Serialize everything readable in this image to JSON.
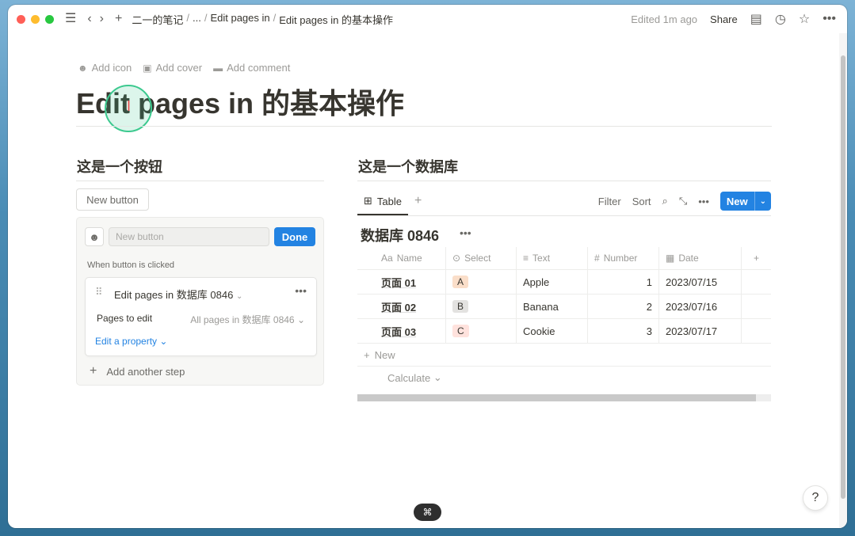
{
  "titlebar": {
    "breadcrumbs": [
      "二一的笔记",
      "...",
      "Edit pages in",
      "Edit pages in 的基本操作"
    ],
    "edited": "Edited 1m ago",
    "share": "Share"
  },
  "page": {
    "actions": [
      "Add icon",
      "Add cover",
      "Add comment"
    ],
    "title": "Edit pages in 的基本操作"
  },
  "left": {
    "heading": "这是一个按钮",
    "new_button_label": "New button",
    "editor": {
      "name_placeholder": "New button",
      "done": "Done",
      "when_label": "When button is clicked",
      "step_title": "Edit pages in 数据库 0846",
      "pages_to_edit_label": "Pages to edit",
      "pages_to_edit_value": "All pages in 数据库 0846",
      "edit_property": "Edit a property",
      "add_step": "Add another step"
    }
  },
  "right": {
    "heading": "这是一个数据库",
    "view_tab": "Table",
    "tools": {
      "filter": "Filter",
      "sort": "Sort",
      "new": "New"
    },
    "db_title": "数据库 0846",
    "columns": {
      "name": "Name",
      "select": "Select",
      "text": "Text",
      "number": "Number",
      "date": "Date"
    },
    "rows": [
      {
        "name": "页面 01",
        "select": "A",
        "select_color": "#fadec9",
        "text": "Apple",
        "number": "1",
        "date": "2023/07/15"
      },
      {
        "name": "页面 02",
        "select": "B",
        "select_color": "#e3e2e0",
        "text": "Banana",
        "number": "2",
        "date": "2023/07/16"
      },
      {
        "name": "页面 03",
        "select": "C",
        "select_color": "#ffe2dd",
        "text": "Cookie",
        "number": "3",
        "date": "2023/07/17"
      }
    ],
    "new_row": "New",
    "calculate": "Calculate"
  },
  "footer": {
    "cmd": "⌘",
    "help": "?"
  },
  "colors": {
    "accent": "#2383e2",
    "text": "#37352f",
    "muted": "#9b9a97"
  }
}
